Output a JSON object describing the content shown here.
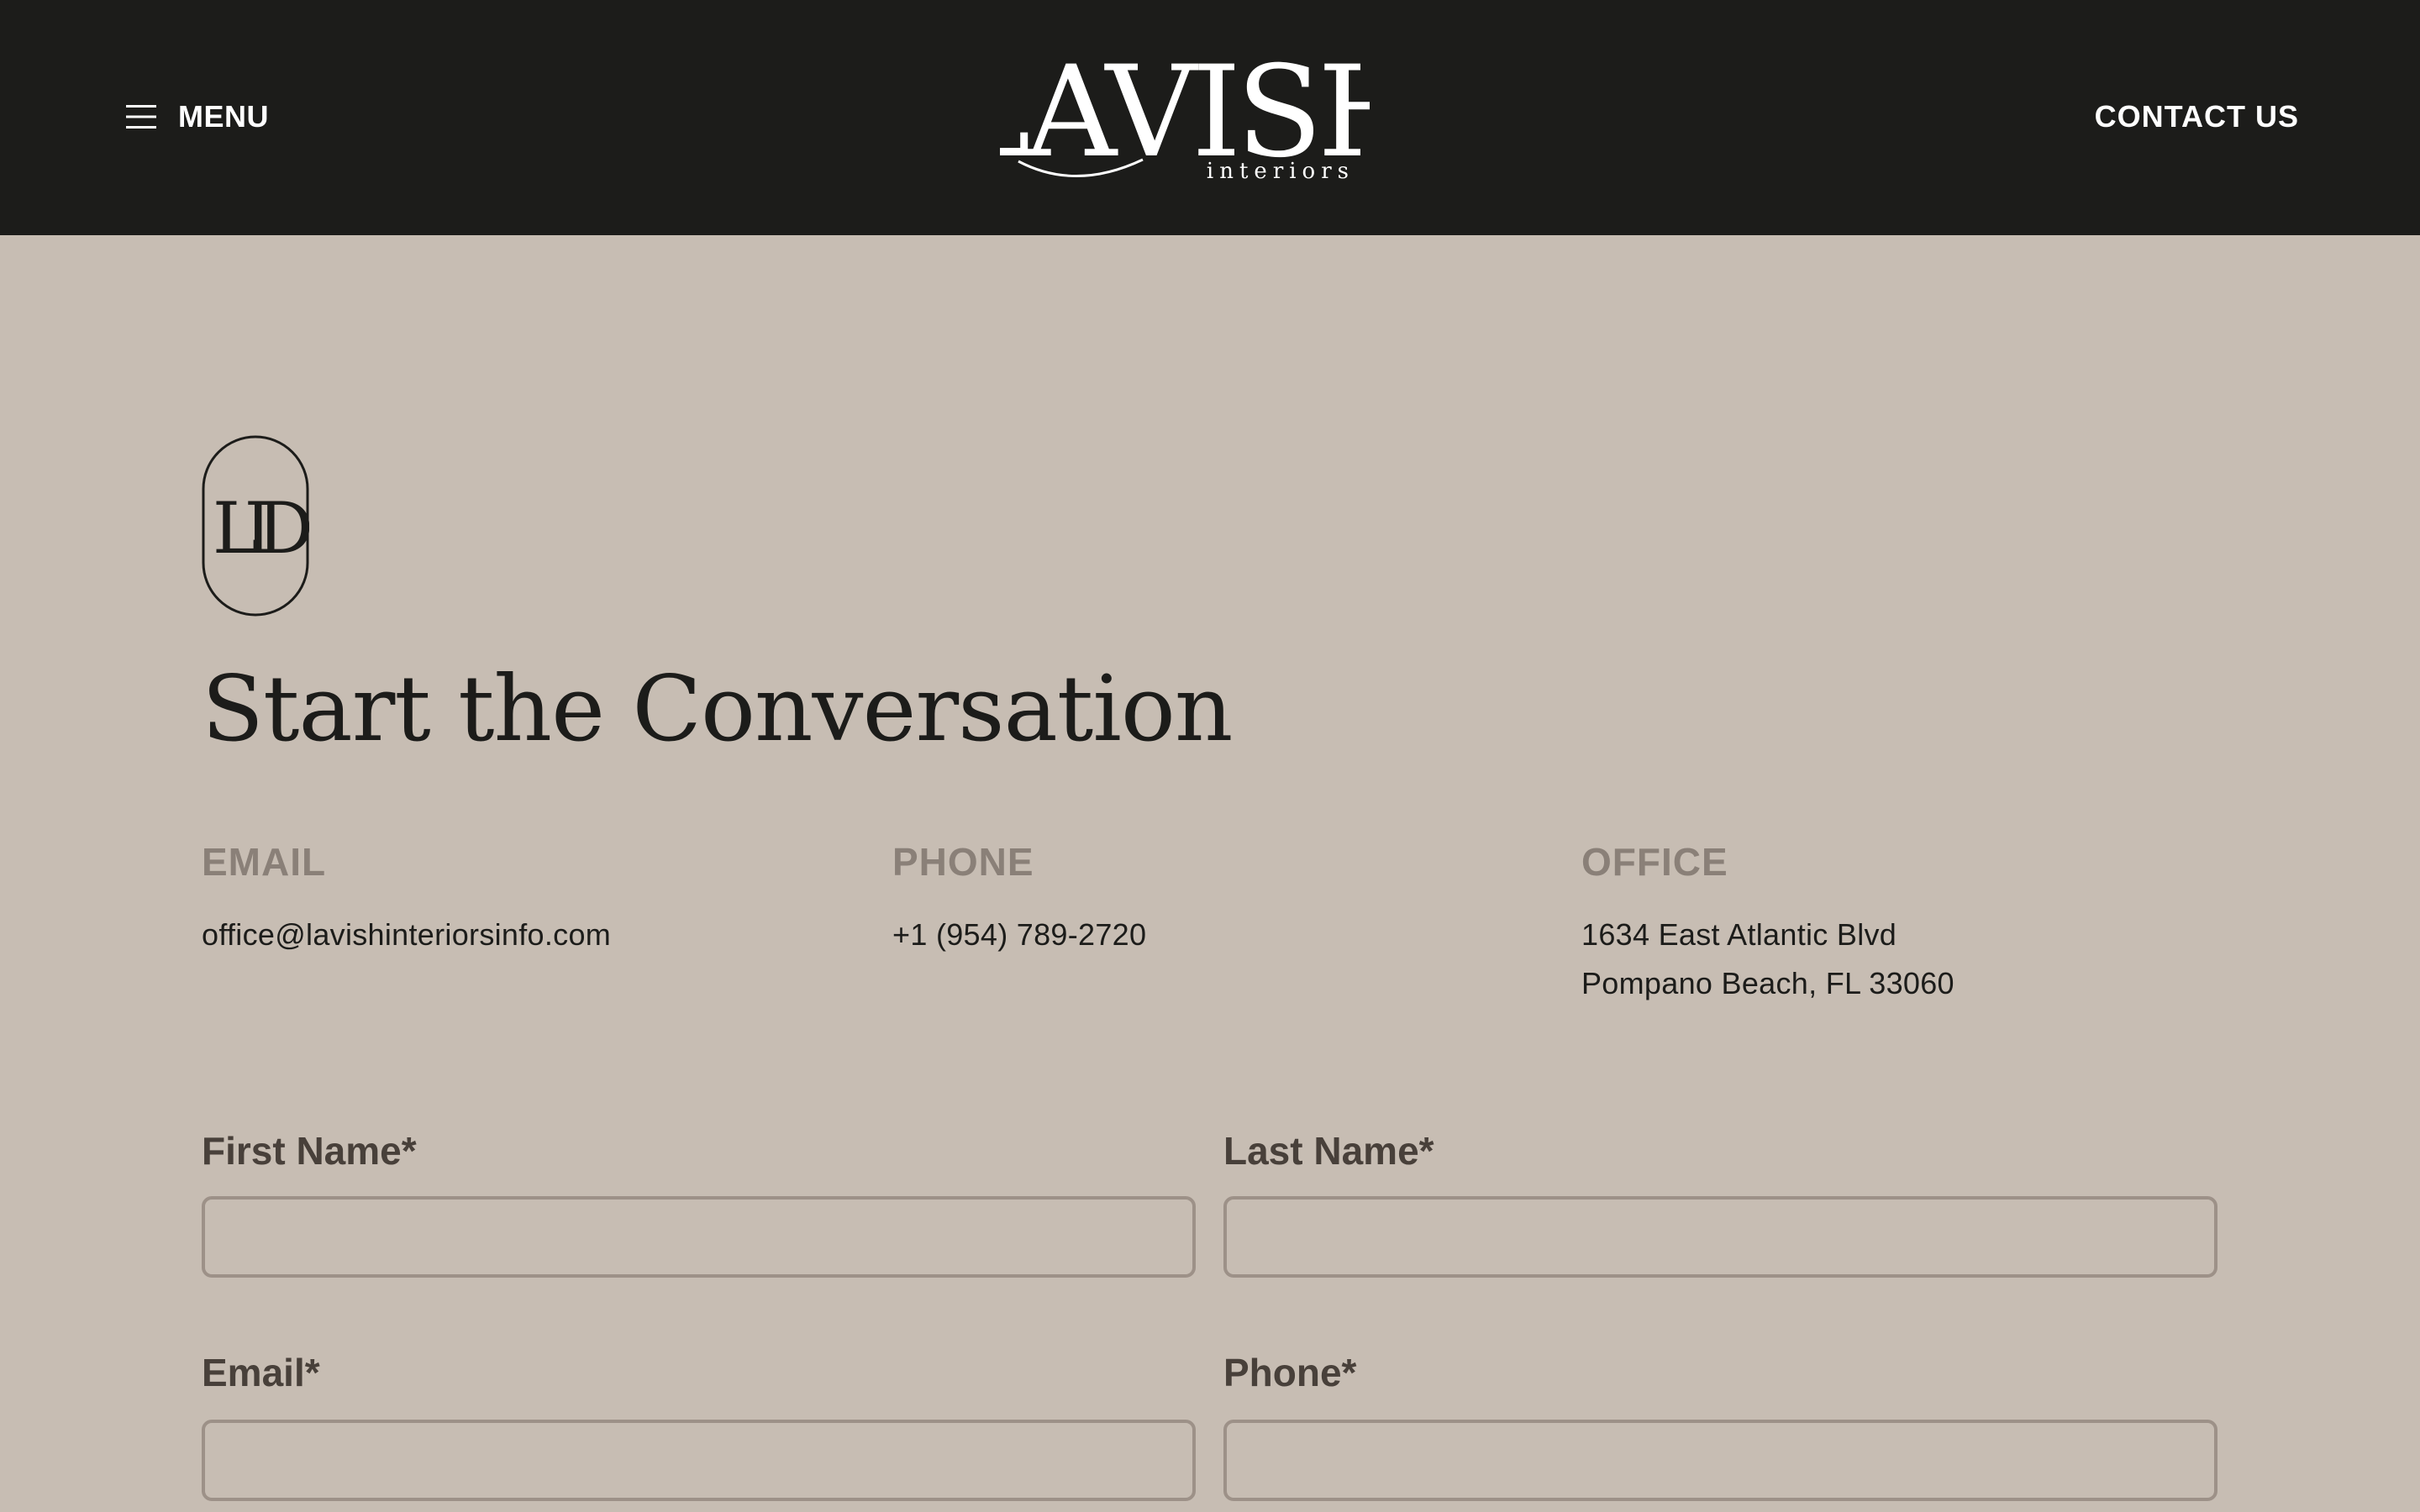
{
  "header": {
    "menu_label": "MENU",
    "menu_icon": "hamburger-icon",
    "logo_main": "LAVISH",
    "logo_sub": "interiors",
    "contact_label": "CONTACT US"
  },
  "monogram": {
    "icon": "lid-monogram-icon",
    "letters": "LID"
  },
  "title": "Start the Conversation",
  "contact_info": {
    "email": {
      "label": "EMAIL",
      "value": "office@lavishinteriorsinfo.com"
    },
    "phone": {
      "label": "PHONE",
      "value": "+1 (954) 789-2720"
    },
    "office": {
      "label": "OFFICE",
      "line1": "1634 East Atlantic Blvd",
      "line2": "Pompano Beach, FL 33060"
    }
  },
  "form": {
    "first_name": {
      "label": "First Name*",
      "value": "",
      "placeholder": ""
    },
    "last_name": {
      "label": "Last Name*",
      "value": "",
      "placeholder": ""
    },
    "email": {
      "label": "Email*",
      "value": "",
      "placeholder": ""
    },
    "phone": {
      "label": "Phone*",
      "value": "",
      "placeholder": ""
    }
  },
  "colors": {
    "header_bg": "#1c1c1a",
    "page_bg": "#c7bdb3",
    "muted_label": "#8a8078",
    "field_label": "#48403a",
    "field_border": "#9d9188"
  }
}
